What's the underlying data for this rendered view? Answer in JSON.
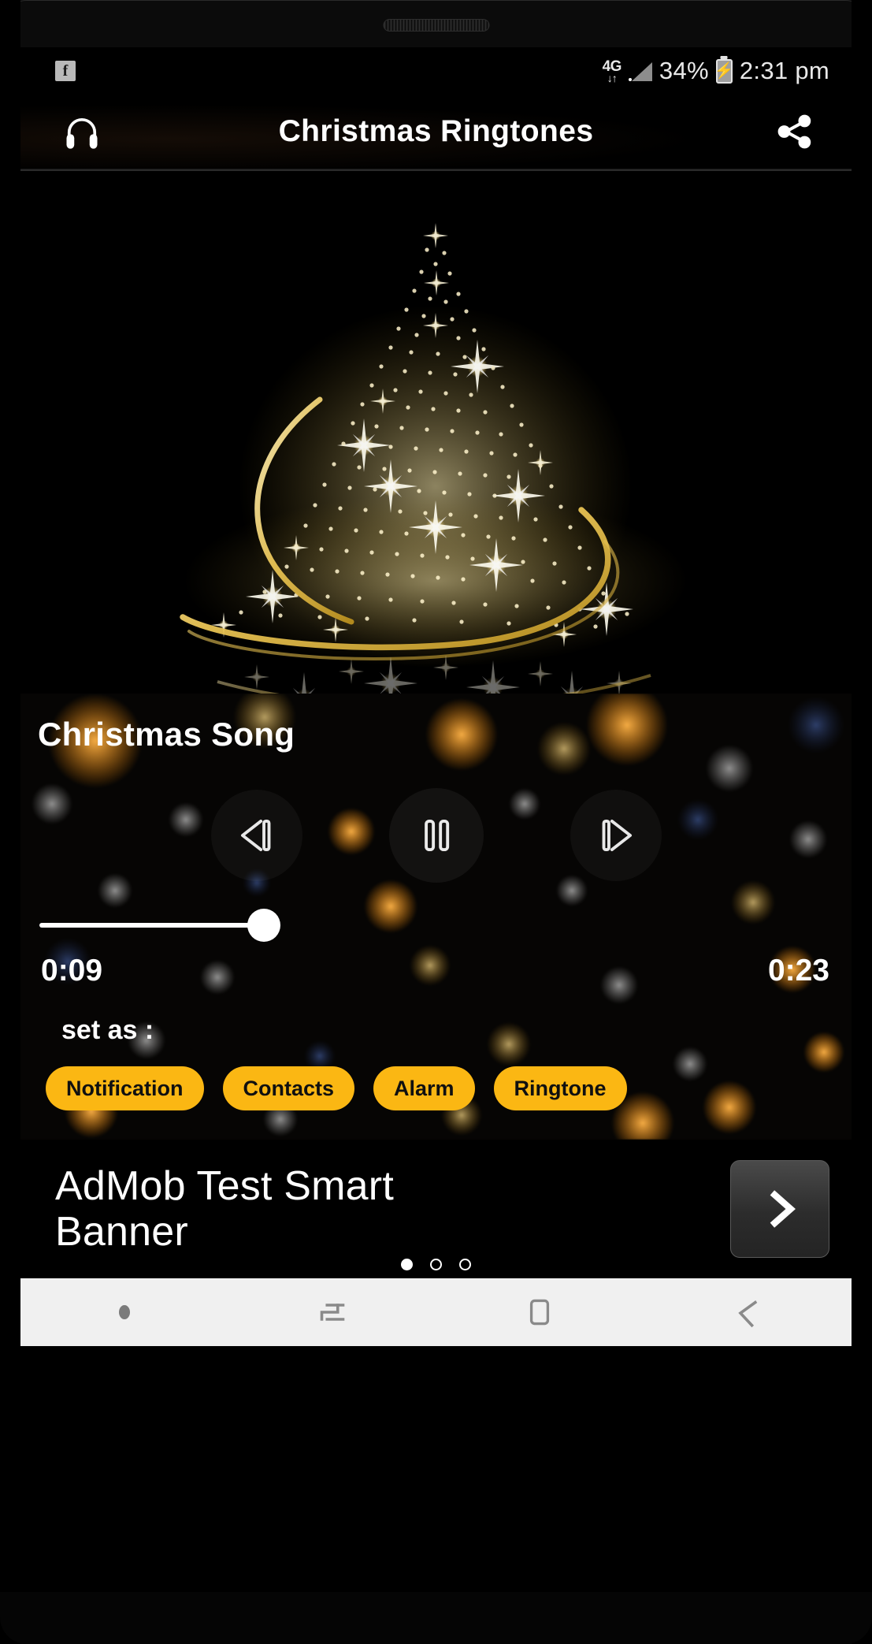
{
  "statusbar": {
    "notification_icon": "facebook-icon",
    "network_label": "4G",
    "network_arrows": "↓↑",
    "battery_percent": "34%",
    "battery_state": "charging",
    "time": "2:31 pm"
  },
  "appbar": {
    "left_icon": "headphones-icon",
    "title": "Christmas Ringtones",
    "right_icon": "share-icon"
  },
  "artwork": {
    "alt": "golden-sparkle-christmas-tree"
  },
  "player": {
    "song_title": "Christmas Song",
    "prev_icon": "previous-track-icon",
    "play_pause_icon": "pause-icon",
    "next_icon": "next-track-icon",
    "elapsed": "0:09",
    "duration": "0:23",
    "progress_percent": 39,
    "set_as_label": "set as :",
    "chips": [
      {
        "label": "Notification",
        "name": "set-as-notification"
      },
      {
        "label": "Contacts",
        "name": "set-as-contacts"
      },
      {
        "label": "Alarm",
        "name": "set-as-alarm"
      },
      {
        "label": "Ringtone",
        "name": "set-as-ringtone"
      }
    ],
    "accent_color": "#fbb713",
    "thumb_color": "#ffffff"
  },
  "ad": {
    "headline_line1": "AdMob Test Smart",
    "headline_line2": "Banner",
    "cta_icon": "chevron-right-icon",
    "dots": 3,
    "active_dot": 0
  },
  "navbar": {
    "dot_icon": "nav-dot-icon",
    "recents_icon": "recents-icon",
    "home_icon": "home-icon",
    "back_icon": "back-icon",
    "background_color": "#f0f0f0"
  }
}
